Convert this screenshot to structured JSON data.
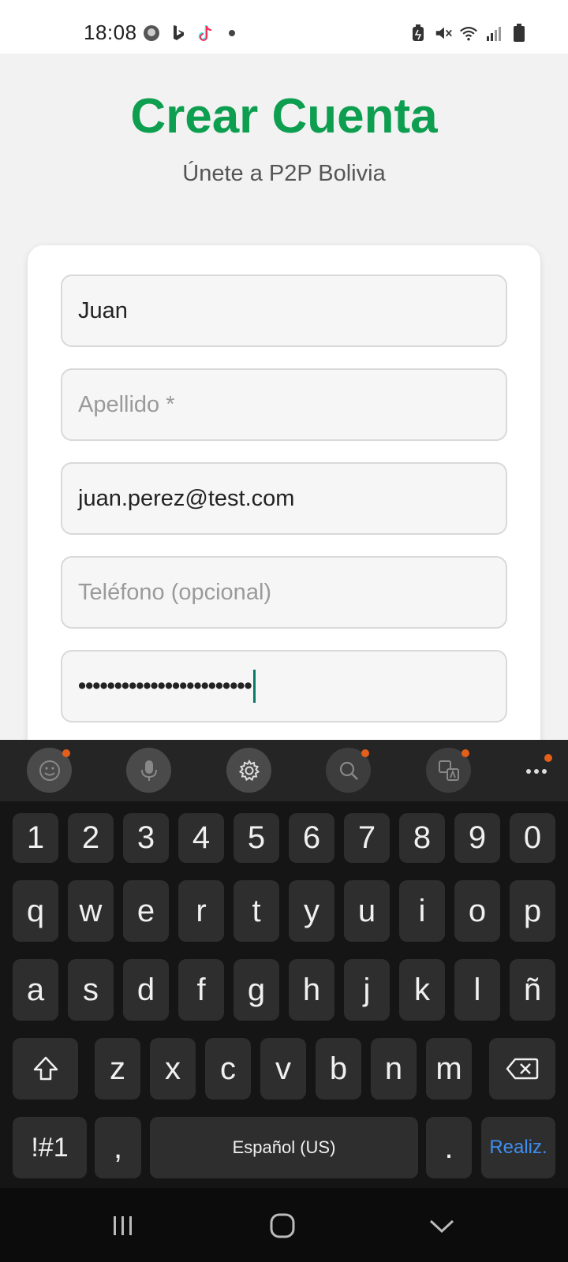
{
  "status_bar": {
    "time": "18:08",
    "left_icons": [
      "clock-app-icon",
      "bing-icon",
      "tiktok-icon",
      "dot-icon"
    ],
    "right_icons": [
      "battery-saver-icon",
      "mute-icon",
      "wifi-icon",
      "signal-icon",
      "battery-icon"
    ]
  },
  "header": {
    "title": "Crear Cuenta",
    "subtitle": "Únete a P2P Bolivia"
  },
  "form": {
    "first_name_value": "Juan",
    "last_name_placeholder": "Apellido *",
    "email_value": "juan.perez@test.com",
    "phone_placeholder": "Teléfono (opcional)",
    "password_masked": "••••••••••••••••••••••••"
  },
  "keyboard": {
    "toolbar": [
      "emoji-icon",
      "microphone-icon",
      "settings-icon",
      "search-icon",
      "translate-icon",
      "more-icon"
    ],
    "rows": [
      [
        "1",
        "2",
        "3",
        "4",
        "5",
        "6",
        "7",
        "8",
        "9",
        "0"
      ],
      [
        "q",
        "w",
        "e",
        "r",
        "t",
        "y",
        "u",
        "i",
        "o",
        "p"
      ],
      [
        "a",
        "s",
        "d",
        "f",
        "g",
        "h",
        "j",
        "k",
        "l",
        "ñ"
      ],
      [
        "z",
        "x",
        "c",
        "v",
        "b",
        "n",
        "m"
      ]
    ],
    "symbols_label": "!#1",
    "comma_label": ",",
    "space_label": "Español (US)",
    "period_label": ".",
    "done_label": "Realiz."
  },
  "colors": {
    "title_green": "#0d9e4f",
    "caret": "#0b7a66",
    "done_blue": "#3f8ff0",
    "notification_dot": "#e35f1c"
  }
}
